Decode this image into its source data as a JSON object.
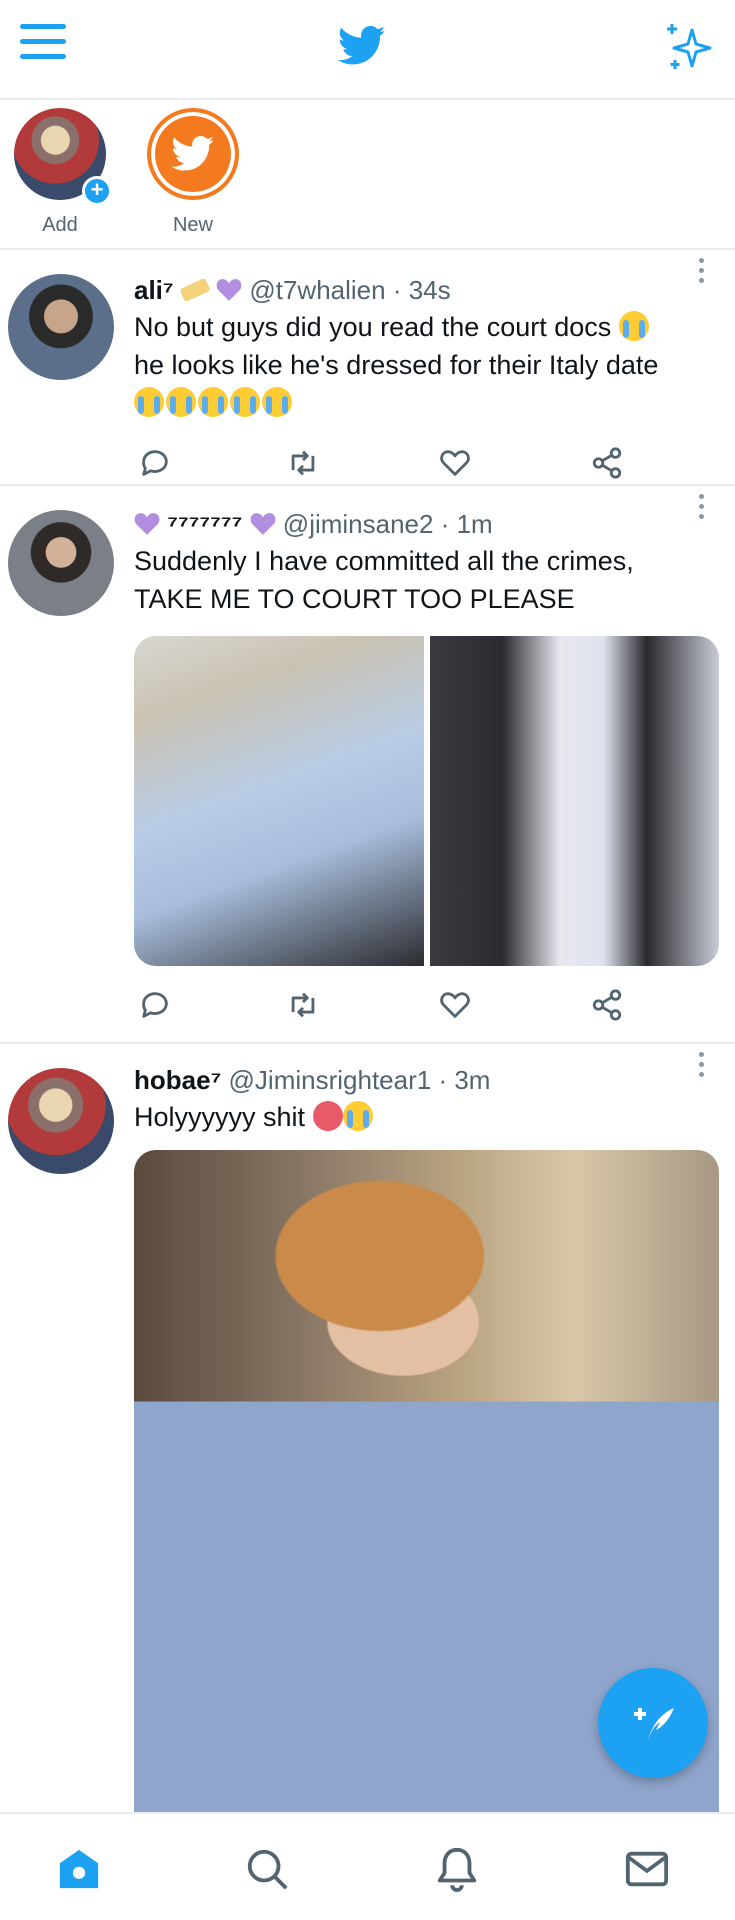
{
  "fleets": [
    {
      "label": "Add"
    },
    {
      "label": "New"
    }
  ],
  "tweets": [
    {
      "name": "ali⁷",
      "handle": "@t7whalien",
      "time": "· 34s",
      "text1": "No but guys did you read the court docs",
      "text2": "he looks like he's dressed for their Italy date"
    },
    {
      "name": "⁷⁷⁷⁷⁷⁷⁷",
      "handle": "@jiminsane2",
      "time": "· 1m",
      "text1": "Suddenly I have committed all the crimes,",
      "text2": "TAKE ME TO COURT TOO PLEASE"
    },
    {
      "name": "hobae⁷",
      "handle": "@Jiminsrightear1",
      "time": "· 3m",
      "text1": "Holyyyyyy shit"
    }
  ],
  "colors": {
    "accent": "#1da1f2",
    "secondary_text": "#536471",
    "divider": "#e6ecf0"
  },
  "icons": [
    "menu-icon",
    "twitter-bird-icon",
    "sparkle-icon",
    "reply-icon",
    "retweet-icon",
    "like-icon",
    "share-icon",
    "compose-icon",
    "home-icon",
    "search-icon",
    "notifications-icon",
    "messages-icon"
  ]
}
